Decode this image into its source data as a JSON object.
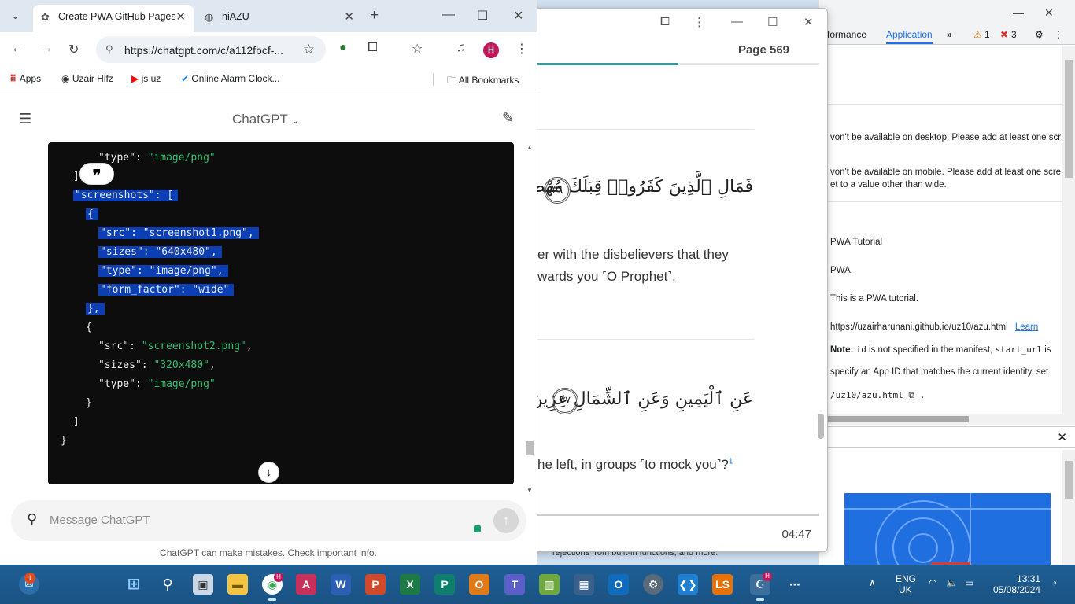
{
  "chrome": {
    "tabs": [
      {
        "label": "Create PWA GitHub Pages",
        "icon": "chatgpt-icon"
      },
      {
        "label": "hiAZU",
        "icon": "globe-icon"
      }
    ],
    "new_tab": "+",
    "url": "https://chatgpt.com/c/a112fbcf-...",
    "profile_initial": "H",
    "bookmarks": [
      {
        "label": "Apps",
        "icon": "apps-grid-icon"
      },
      {
        "label": "Uzair Hifz",
        "icon": "site-icon"
      },
      {
        "label": "js uz",
        "icon": "youtube-icon"
      },
      {
        "label": "Online Alarm Clock...",
        "icon": "alarm-check-icon"
      }
    ],
    "all_bookmarks": "All Bookmarks"
  },
  "chat": {
    "title": "ChatGPT",
    "code_lines": [
      {
        "indent": 4,
        "tokens": [
          {
            "t": "\"type\"",
            "c": "k"
          },
          {
            "t": ": ",
            "c": "k"
          },
          {
            "t": "\"image/png\"",
            "c": "s"
          }
        ],
        "selected": false
      },
      {
        "indent": 2,
        "tokens": [
          {
            "t": "],",
            "c": "k"
          }
        ],
        "selected": false
      },
      {
        "indent": 2,
        "tokens": [
          {
            "t": "\"screenshots\": [",
            "c": "k"
          }
        ],
        "selected": true
      },
      {
        "indent": 3,
        "tokens": [
          {
            "t": "{",
            "c": "k"
          }
        ],
        "selected": true
      },
      {
        "indent": 4,
        "tokens": [
          {
            "t": "\"src\": \"screenshot1.png\",",
            "c": "k"
          }
        ],
        "selected": true
      },
      {
        "indent": 4,
        "tokens": [
          {
            "t": "\"sizes\": \"640x480\",",
            "c": "k"
          }
        ],
        "selected": true
      },
      {
        "indent": 4,
        "tokens": [
          {
            "t": "\"type\": \"image/png\",",
            "c": "k"
          }
        ],
        "selected": true
      },
      {
        "indent": 4,
        "tokens": [
          {
            "t": "\"form_factor\": \"wide\"",
            "c": "k"
          }
        ],
        "selected": true
      },
      {
        "indent": 3,
        "tokens": [
          {
            "t": "},",
            "c": "k"
          }
        ],
        "selected": true
      },
      {
        "indent": 3,
        "tokens": [
          {
            "t": "{",
            "c": "k"
          }
        ],
        "selected": false
      },
      {
        "indent": 4,
        "tokens": [
          {
            "t": "\"src\"",
            "c": "k"
          },
          {
            "t": ": ",
            "c": "k"
          },
          {
            "t": "\"screenshot2.png\"",
            "c": "s"
          },
          {
            "t": ",",
            "c": "k"
          }
        ],
        "selected": false
      },
      {
        "indent": 4,
        "tokens": [
          {
            "t": "\"sizes\"",
            "c": "k"
          },
          {
            "t": ": ",
            "c": "k"
          },
          {
            "t": "\"320x480\"",
            "c": "s"
          },
          {
            "t": ",",
            "c": "k"
          }
        ],
        "selected": false
      },
      {
        "indent": 4,
        "tokens": [
          {
            "t": "\"type\"",
            "c": "k"
          },
          {
            "t": ": ",
            "c": "k"
          },
          {
            "t": "\"image/png\"",
            "c": "s"
          }
        ],
        "selected": false
      },
      {
        "indent": 3,
        "tokens": [
          {
            "t": "}",
            "c": "k"
          }
        ],
        "selected": false
      },
      {
        "indent": 2,
        "tokens": [
          {
            "t": "]",
            "c": "k"
          }
        ],
        "selected": false
      },
      {
        "indent": 1,
        "tokens": [
          {
            "t": "}",
            "c": "k"
          }
        ],
        "selected": false
      }
    ],
    "composer_placeholder": "Message ChatGPT",
    "disclaimer": "ChatGPT can make mistakes. Check important info."
  },
  "quran": {
    "page_label": "Page 569",
    "page_progress": 0.5,
    "verses": [
      {
        "arabic": "فَمَالِ ٱلَّذِينَ كَفَرُوا۟ قِبَلَكَ مُهْطِعِينَ",
        "number": "٣٦",
        "translation_1": "er with the disbelievers that they",
        "translation_2": "wards you ˹O Prophet˺,"
      },
      {
        "arabic": "عَنِ ٱلْيَمِينِ وَعَنِ ٱلشِّمَالِ عِزِينَ",
        "number": "٣٧",
        "translation_1": "he left, in groups ˹to mock you˺?",
        "footnote": "1"
      }
    ],
    "time": "04:47",
    "underlying_text": "rejections from built-in functions, and more."
  },
  "devtools": {
    "tabs": [
      "formance",
      "Application"
    ],
    "warnings": "1",
    "errors": "3",
    "lines": [
      "von't be available on desktop. Please add at least one scr",
      "von't be available on mobile. Please add at least one scre",
      "et to a value other than wide.",
      "PWA Tutorial",
      "PWA",
      "This is a PWA tutorial.",
      "https://uzairharunani.github.io/uz10/azu.html",
      "Learn",
      "Note:",
      "id",
      " is not specified in the manifest, ",
      "start_url",
      " is",
      "specify an App ID that matches the current identity, set",
      "/uz10/azu.html"
    ]
  },
  "taskbar": {
    "notification_badge": "1",
    "chrome_badge": "H",
    "lang_1": "ENG",
    "lang_2": "UK",
    "time": "13:31",
    "date": "05/08/2024"
  }
}
